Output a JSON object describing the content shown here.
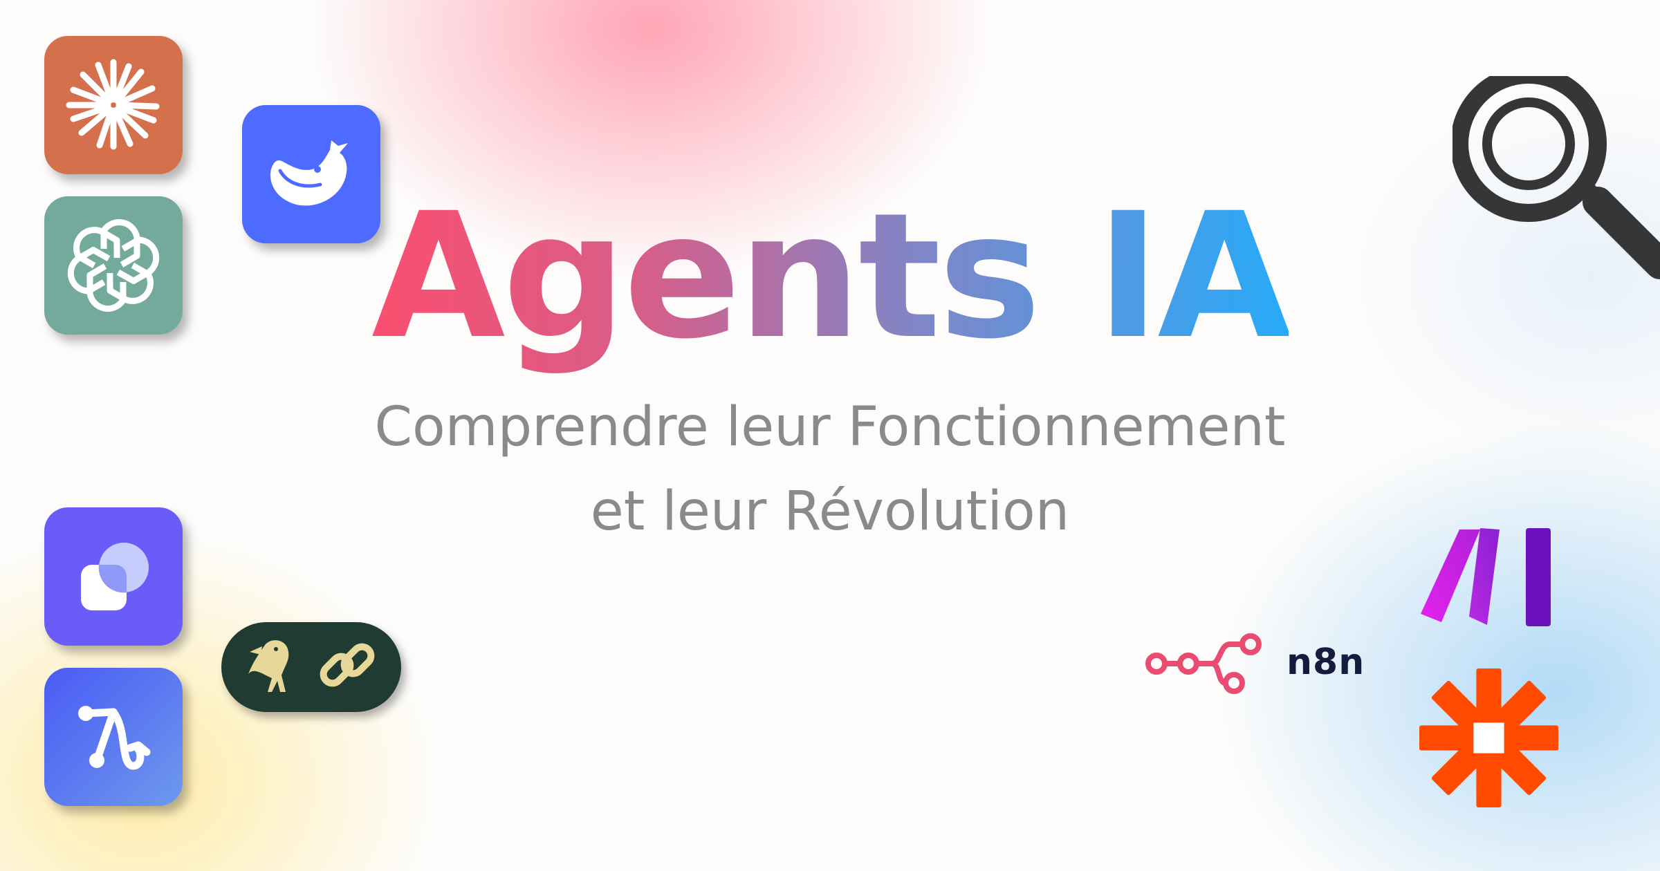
{
  "title": "Agents IA",
  "subtitle_line1": "Comprendre leur Fonctionnement",
  "subtitle_line2": "et leur Révolution",
  "n8n_label": "n8n",
  "colors": {
    "title_gradient": [
      "#fa4f6f",
      "#d65e8a",
      "#7f86c8",
      "#27aaf8"
    ],
    "subtitle": "#8a8a8d",
    "claude_tile": "#d5704c",
    "chatgpt_tile": "#74aa9c",
    "deepseek_tile": "#4d6bfe",
    "tile_purple": "#6a5cf8",
    "langgraph_tile": "#4a63f5",
    "langchain_pill": "#1f3b32",
    "zapier": "#ff4a00",
    "make": "#9b1bd9",
    "n8n_pink": "#ea4b71"
  },
  "icons": [
    "claude-icon",
    "deepseek-icon",
    "chatgpt-icon",
    "assistant-icon",
    "langgraph-icon",
    "langchain-icon",
    "magnifier-icon",
    "make-icon",
    "n8n-icon",
    "zapier-icon"
  ]
}
